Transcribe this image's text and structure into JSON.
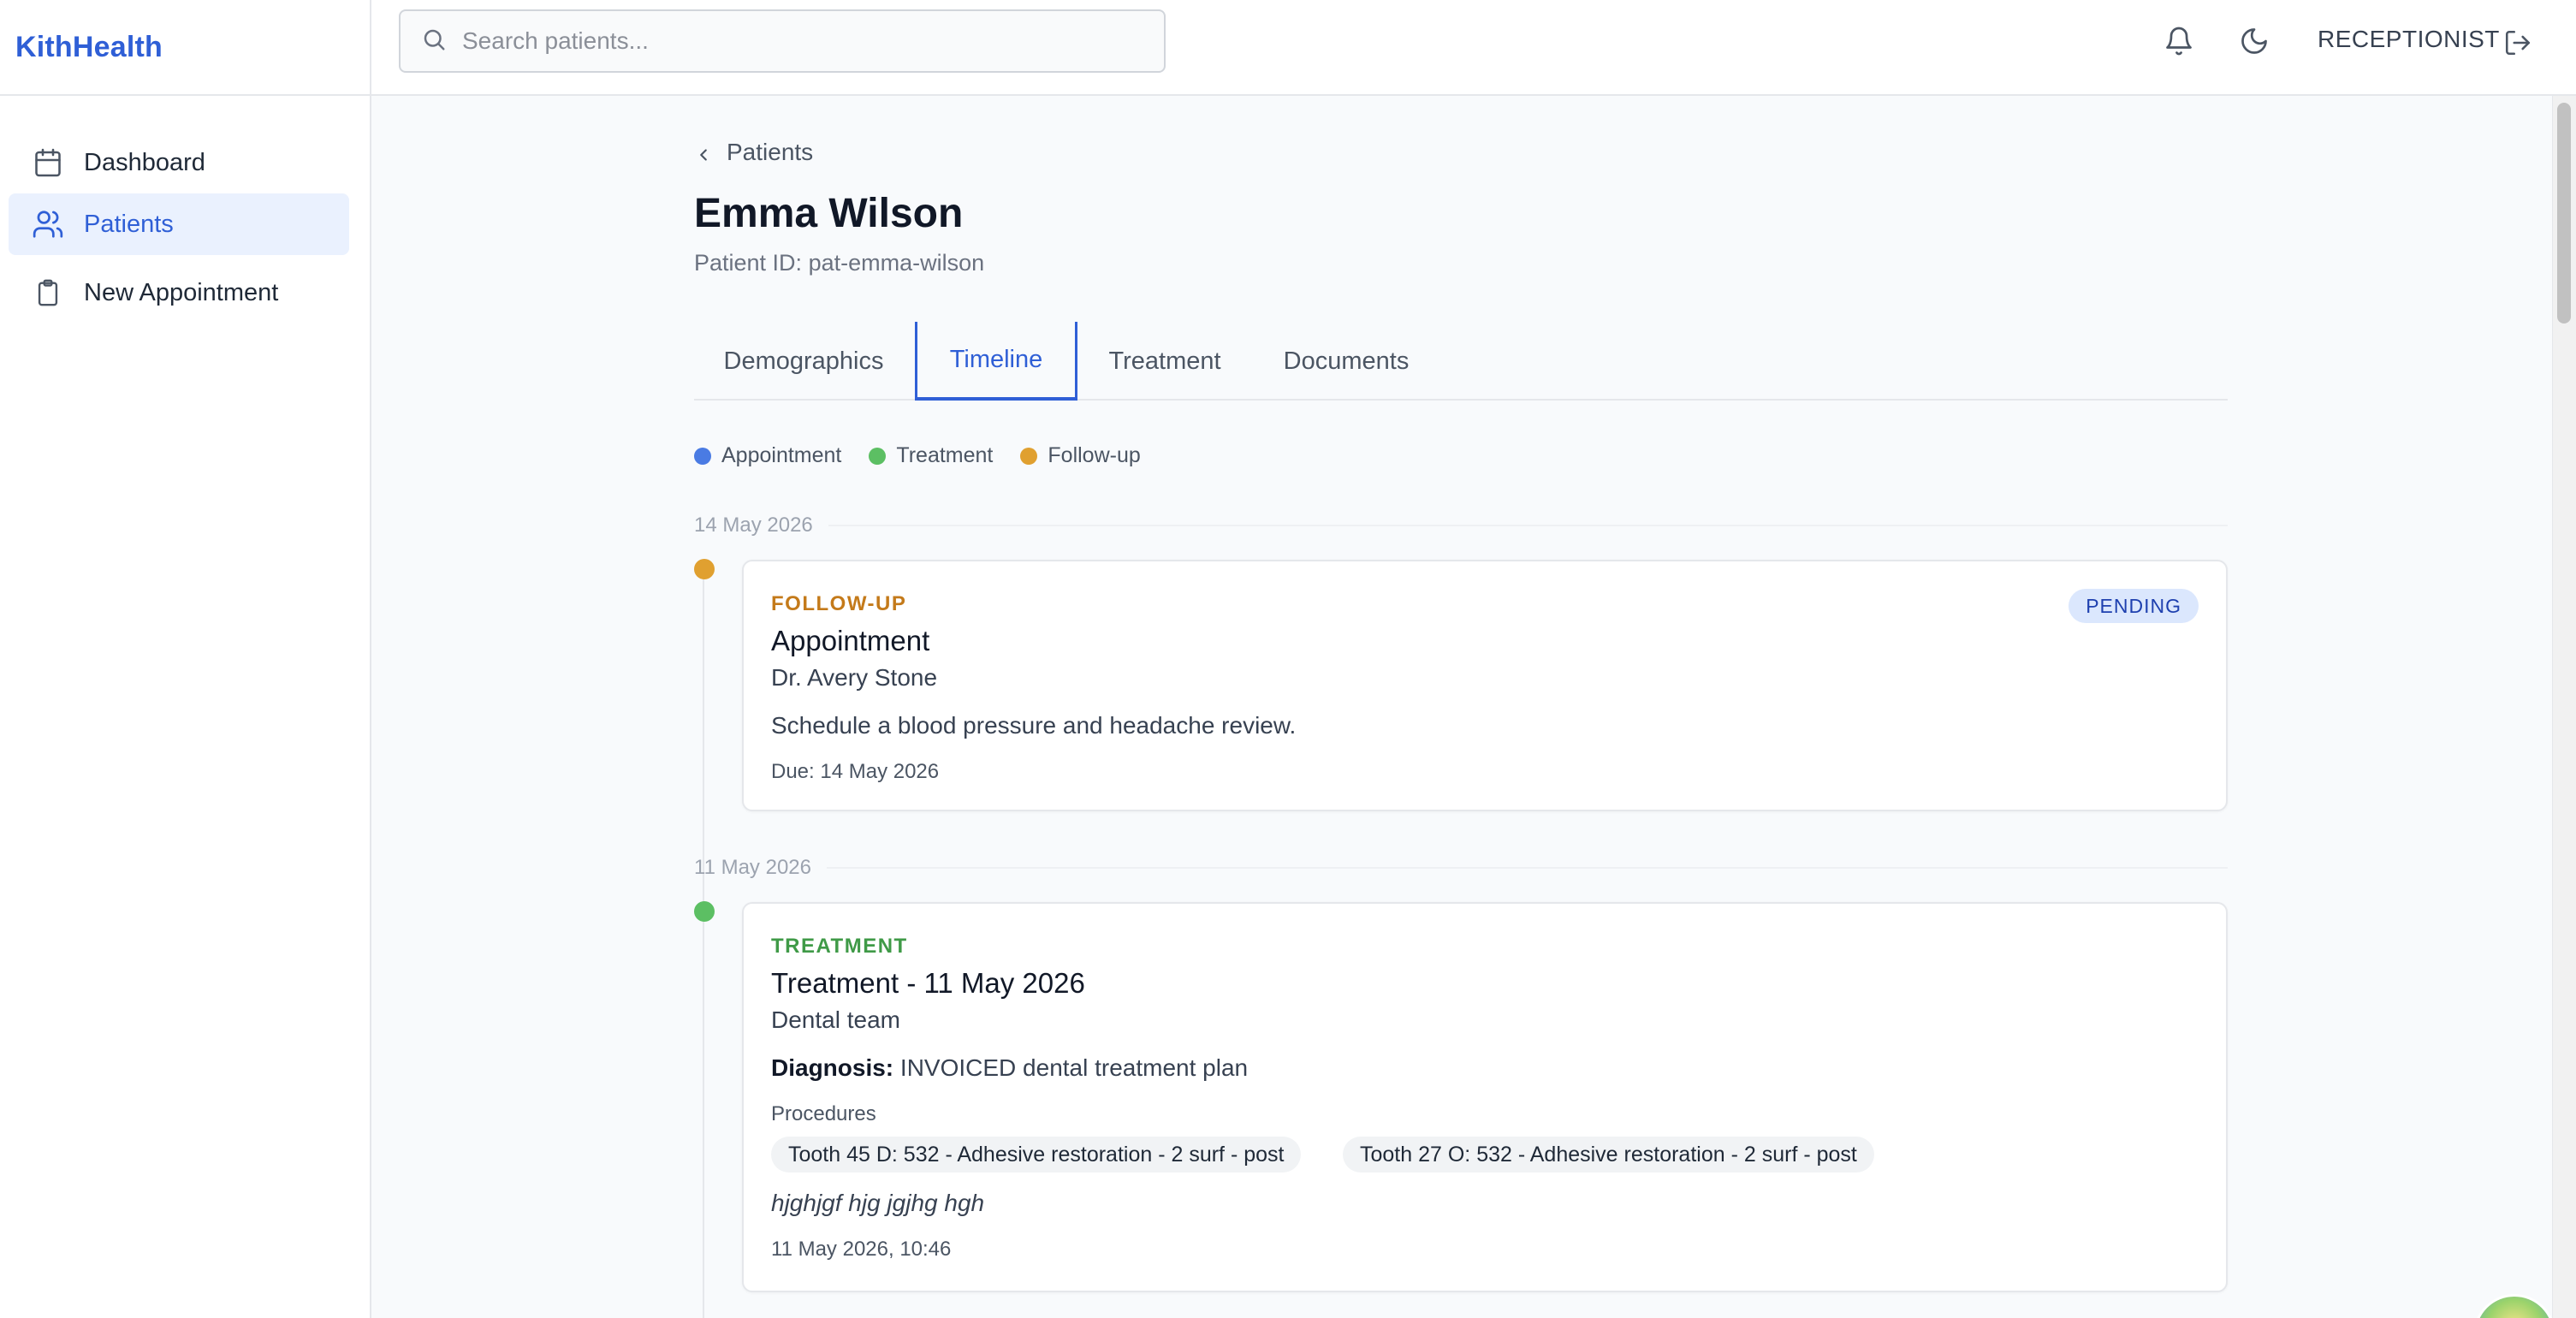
{
  "brand": "KithHealth",
  "search": {
    "placeholder": "Search patients..."
  },
  "header": {
    "role": "RECEPTIONIST",
    "icons": [
      "bell-icon",
      "moon-icon",
      "logout-icon"
    ]
  },
  "sidebar": {
    "items": [
      {
        "label": "Dashboard",
        "icon": "calendar-icon",
        "active": false
      },
      {
        "label": "Patients",
        "icon": "users-icon",
        "active": true
      },
      {
        "label": "New Appointment",
        "icon": "clipboard-icon",
        "active": false
      }
    ]
  },
  "main": {
    "back_label": "Patients",
    "patient_name": "Emma Wilson",
    "patient_id": "Patient ID: pat-emma-wilson",
    "tabs": [
      {
        "label": "Demographics",
        "active": false
      },
      {
        "label": "Timeline",
        "active": true
      },
      {
        "label": "Treatment",
        "active": false
      },
      {
        "label": "Documents",
        "active": false
      }
    ],
    "legend": [
      {
        "label": "Appointment",
        "color": "#4a7be3"
      },
      {
        "label": "Treatment",
        "color": "#5cbf63"
      },
      {
        "label": "Follow-up",
        "color": "#e0a030"
      }
    ],
    "timeline": [
      {
        "date": "14 May 2026",
        "kind": "FOLLOW-UP",
        "kind_color": "#c47a1a",
        "dot_color": "#e0a030",
        "title": "Appointment",
        "subtitle": "Dr. Avery Stone",
        "body": "Schedule a blood pressure and headache review.",
        "meta": "Due: 14 May 2026",
        "badge": "PENDING"
      },
      {
        "date": "11 May 2026",
        "kind": "TREATMENT",
        "kind_color": "#3f9a47",
        "dot_color": "#5cbf63",
        "title": "Treatment - 11 May 2026",
        "subtitle": "Dental team",
        "diagnosis_label": "Diagnosis:",
        "diagnosis_value": "INVOICED dental treatment plan",
        "procedures_label": "Procedures",
        "procedures": [
          "Tooth 45 D: 532 - Adhesive restoration - 2 surf - post",
          "Tooth 27 O: 532 - Adhesive restoration - 2 surf - post"
        ],
        "note": "hjghjgf hjg jgjhg hgh",
        "meta": "11 May 2026, 10:46"
      }
    ]
  }
}
